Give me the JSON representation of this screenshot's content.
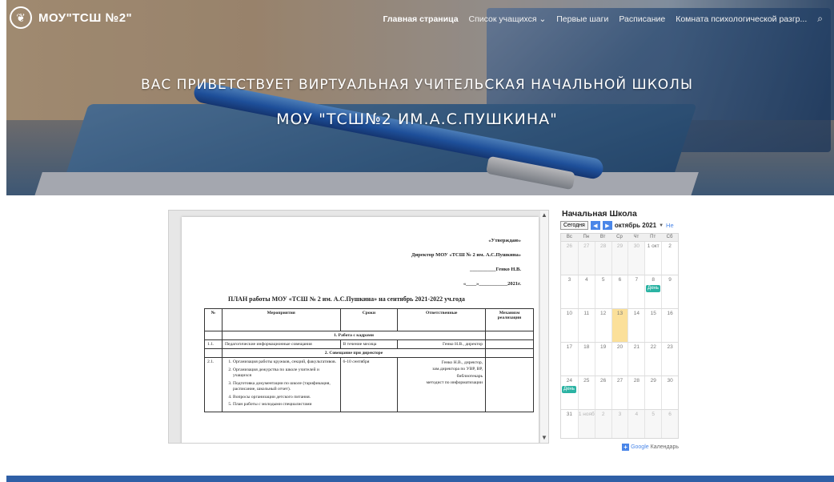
{
  "site": {
    "logo_text": "МОУ\"ТСШ №2\""
  },
  "nav": {
    "items": [
      "Главная страница",
      "Список учащихся",
      "Первые шаги",
      "Расписание",
      "Комната психологической разгр..."
    ],
    "dropdown_caret": "⌄"
  },
  "hero": {
    "line1": "ВАС ПРИВЕТСТВУЕТ ВИРТУАЛЬНАЯ УЧИТЕЛЬСКАЯ НАЧАЛЬНОЙ ШКОЛЫ",
    "line2": "МОУ \"ТСШ№2 ИМ.А.С.ПУШКИНА\""
  },
  "document": {
    "approve_1": "«Утверждаю»",
    "approve_2": "Директор МОУ «ТСШ № 2 им. А.С.Пушкина»",
    "approve_3": "__________Генко Н.В.",
    "approve_4": "«____»___________2021г.",
    "title": "ПЛАН работы МОУ «ТСШ № 2 им. А.С.Пушкина» на сентябрь 2021-2022 уч.года",
    "headers": [
      "№",
      "Мероприятия",
      "Сроки",
      "Ответственные",
      "Механизм реализации"
    ],
    "section_1": "1. Работа с кадрами",
    "row_1": [
      "1.1.",
      "Педагогические информационные совещания",
      "В течение месяца",
      "Генко Н.В., директор",
      ""
    ],
    "section_2": "2. Совещание при директоре",
    "row_2_num": "2.1.",
    "row_2_tasks": [
      "Организация работы кружков, секций, факультативов.",
      "Организация дежурства по школе учителей и учащихся",
      "Подготовка документации по школе (тарификация, расписание, школьный отчет).",
      "Вопросы организации детского питания.",
      "План работы с молодыми специалистами"
    ],
    "row_2_dates": "6-10 сентября",
    "row_2_resp": [
      "Генко Н.В., директор,",
      "зам.директора по УВР, ВР,",
      "библиотекарь",
      "методист по информатизации"
    ]
  },
  "calendar": {
    "title": "Начальная Школа",
    "today_label": "Сегодня",
    "month_label": "октябрь 2021",
    "week_link": "Не",
    "dow": [
      "Вс",
      "Пн",
      "Вт",
      "Ср",
      "Чт",
      "Пт",
      "Сб"
    ],
    "weeks": [
      [
        "26",
        "27",
        "28",
        "29",
        "30",
        "1 окт",
        "2"
      ],
      [
        "3",
        "4",
        "5",
        "6",
        "7",
        "8",
        "9"
      ],
      [
        "10",
        "11",
        "12",
        "13",
        "14",
        "15",
        "16"
      ],
      [
        "17",
        "18",
        "19",
        "20",
        "21",
        "22",
        "23"
      ],
      [
        "24",
        "25",
        "26",
        "27",
        "28",
        "29",
        "30"
      ],
      [
        "31",
        "1 нояб",
        "2",
        "3",
        "4",
        "5",
        "6"
      ]
    ],
    "event_label": "День",
    "footer_label": "Календарь",
    "footer_brand": "Google"
  }
}
